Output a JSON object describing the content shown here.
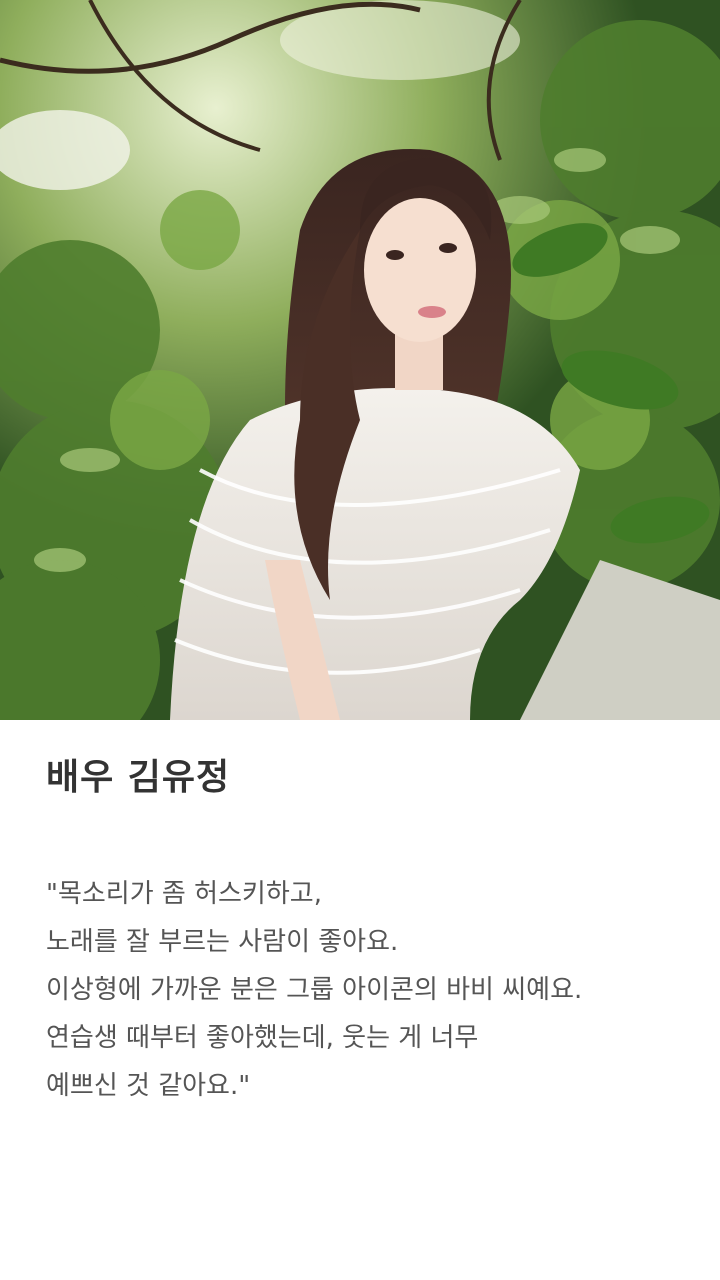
{
  "photo": {
    "subject_icon": "portrait-photo"
  },
  "title": "배우 김유정",
  "quote_lines": [
    "\"목소리가 좀 허스키하고,",
    "노래를 잘 부르는 사람이 좋아요.",
    "이상형에 가까운 분은 그룹 아이콘의 바비 씨예요.",
    "연습생 때부터 좋아했는데, 웃는 게 너무",
    "예쁘신 것 같아요.\""
  ]
}
